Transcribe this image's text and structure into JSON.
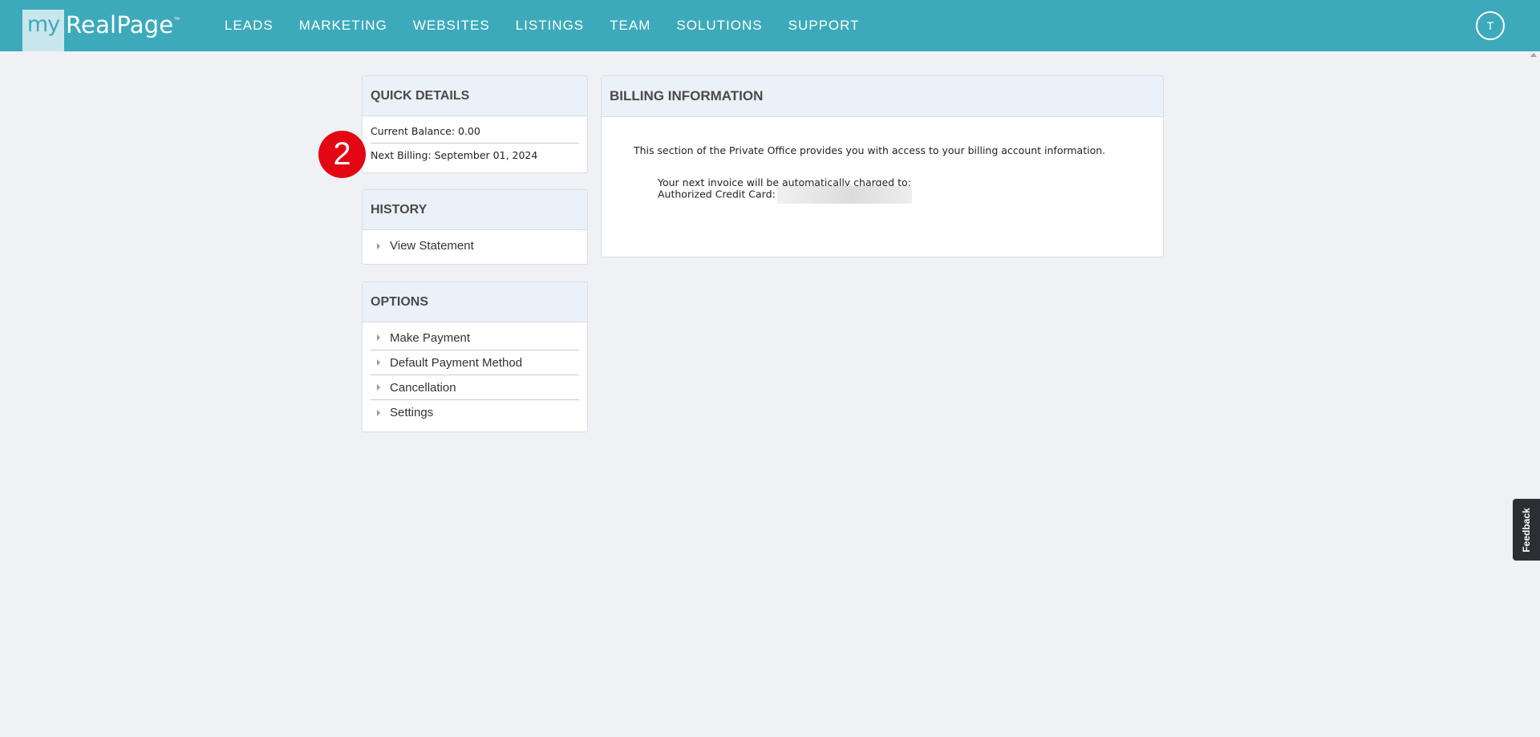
{
  "header": {
    "logo": {
      "my": "my",
      "brand": "RealPage",
      "tm": "™"
    },
    "nav": [
      "LEADS",
      "MARKETING",
      "WEBSITES",
      "LISTINGS",
      "TEAM",
      "SOLUTIONS",
      "SUPPORT"
    ],
    "avatar_initial": "T",
    "colors": {
      "bar": "#3caabb"
    }
  },
  "quick_details": {
    "title": "QUICK DETAILS",
    "current_balance": "Current Balance: 0.00",
    "next_billing": "Next Billing: September 01, 2024"
  },
  "history": {
    "title": "HISTORY",
    "items": [
      "View Statement"
    ]
  },
  "options": {
    "title": "OPTIONS",
    "items": [
      "Make Payment",
      "Default Payment Method",
      "Cancellation",
      "Settings"
    ]
  },
  "billing": {
    "title": "BILLING INFORMATION",
    "intro": "This section of the Private Office provides you with access to your billing account information.",
    "invoice_line": "Your next invoice will be automatically charged to:",
    "card_label": "Authorized Credit Card:"
  },
  "annotation": {
    "step": "2",
    "color": "#e30613"
  },
  "feedback_label": "Feedback"
}
